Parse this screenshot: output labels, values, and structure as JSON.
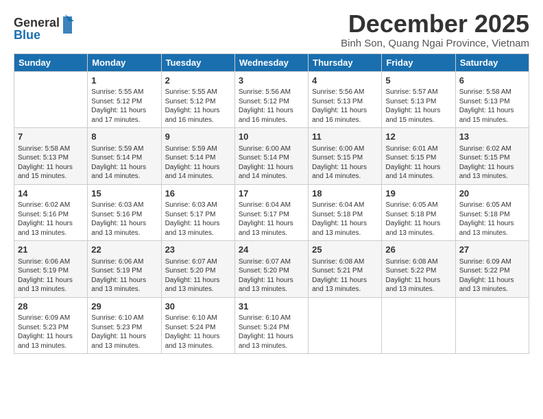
{
  "logo": {
    "line1": "General",
    "line2": "Blue"
  },
  "title": "December 2025",
  "subtitle": "Binh Son, Quang Ngai Province, Vietnam",
  "calendar": {
    "headers": [
      "Sunday",
      "Monday",
      "Tuesday",
      "Wednesday",
      "Thursday",
      "Friday",
      "Saturday"
    ],
    "weeks": [
      [
        {
          "day": "",
          "info": ""
        },
        {
          "day": "1",
          "info": "Sunrise: 5:55 AM\nSunset: 5:12 PM\nDaylight: 11 hours\nand 17 minutes."
        },
        {
          "day": "2",
          "info": "Sunrise: 5:55 AM\nSunset: 5:12 PM\nDaylight: 11 hours\nand 16 minutes."
        },
        {
          "day": "3",
          "info": "Sunrise: 5:56 AM\nSunset: 5:12 PM\nDaylight: 11 hours\nand 16 minutes."
        },
        {
          "day": "4",
          "info": "Sunrise: 5:56 AM\nSunset: 5:13 PM\nDaylight: 11 hours\nand 16 minutes."
        },
        {
          "day": "5",
          "info": "Sunrise: 5:57 AM\nSunset: 5:13 PM\nDaylight: 11 hours\nand 15 minutes."
        },
        {
          "day": "6",
          "info": "Sunrise: 5:58 AM\nSunset: 5:13 PM\nDaylight: 11 hours\nand 15 minutes."
        }
      ],
      [
        {
          "day": "7",
          "info": "Sunrise: 5:58 AM\nSunset: 5:13 PM\nDaylight: 11 hours\nand 15 minutes."
        },
        {
          "day": "8",
          "info": "Sunrise: 5:59 AM\nSunset: 5:14 PM\nDaylight: 11 hours\nand 14 minutes."
        },
        {
          "day": "9",
          "info": "Sunrise: 5:59 AM\nSunset: 5:14 PM\nDaylight: 11 hours\nand 14 minutes."
        },
        {
          "day": "10",
          "info": "Sunrise: 6:00 AM\nSunset: 5:14 PM\nDaylight: 11 hours\nand 14 minutes."
        },
        {
          "day": "11",
          "info": "Sunrise: 6:00 AM\nSunset: 5:15 PM\nDaylight: 11 hours\nand 14 minutes."
        },
        {
          "day": "12",
          "info": "Sunrise: 6:01 AM\nSunset: 5:15 PM\nDaylight: 11 hours\nand 14 minutes."
        },
        {
          "day": "13",
          "info": "Sunrise: 6:02 AM\nSunset: 5:15 PM\nDaylight: 11 hours\nand 13 minutes."
        }
      ],
      [
        {
          "day": "14",
          "info": "Sunrise: 6:02 AM\nSunset: 5:16 PM\nDaylight: 11 hours\nand 13 minutes."
        },
        {
          "day": "15",
          "info": "Sunrise: 6:03 AM\nSunset: 5:16 PM\nDaylight: 11 hours\nand 13 minutes."
        },
        {
          "day": "16",
          "info": "Sunrise: 6:03 AM\nSunset: 5:17 PM\nDaylight: 11 hours\nand 13 minutes."
        },
        {
          "day": "17",
          "info": "Sunrise: 6:04 AM\nSunset: 5:17 PM\nDaylight: 11 hours\nand 13 minutes."
        },
        {
          "day": "18",
          "info": "Sunrise: 6:04 AM\nSunset: 5:18 PM\nDaylight: 11 hours\nand 13 minutes."
        },
        {
          "day": "19",
          "info": "Sunrise: 6:05 AM\nSunset: 5:18 PM\nDaylight: 11 hours\nand 13 minutes."
        },
        {
          "day": "20",
          "info": "Sunrise: 6:05 AM\nSunset: 5:18 PM\nDaylight: 11 hours\nand 13 minutes."
        }
      ],
      [
        {
          "day": "21",
          "info": "Sunrise: 6:06 AM\nSunset: 5:19 PM\nDaylight: 11 hours\nand 13 minutes."
        },
        {
          "day": "22",
          "info": "Sunrise: 6:06 AM\nSunset: 5:19 PM\nDaylight: 11 hours\nand 13 minutes."
        },
        {
          "day": "23",
          "info": "Sunrise: 6:07 AM\nSunset: 5:20 PM\nDaylight: 11 hours\nand 13 minutes."
        },
        {
          "day": "24",
          "info": "Sunrise: 6:07 AM\nSunset: 5:20 PM\nDaylight: 11 hours\nand 13 minutes."
        },
        {
          "day": "25",
          "info": "Sunrise: 6:08 AM\nSunset: 5:21 PM\nDaylight: 11 hours\nand 13 minutes."
        },
        {
          "day": "26",
          "info": "Sunrise: 6:08 AM\nSunset: 5:22 PM\nDaylight: 11 hours\nand 13 minutes."
        },
        {
          "day": "27",
          "info": "Sunrise: 6:09 AM\nSunset: 5:22 PM\nDaylight: 11 hours\nand 13 minutes."
        }
      ],
      [
        {
          "day": "28",
          "info": "Sunrise: 6:09 AM\nSunset: 5:23 PM\nDaylight: 11 hours\nand 13 minutes."
        },
        {
          "day": "29",
          "info": "Sunrise: 6:10 AM\nSunset: 5:23 PM\nDaylight: 11 hours\nand 13 minutes."
        },
        {
          "day": "30",
          "info": "Sunrise: 6:10 AM\nSunset: 5:24 PM\nDaylight: 11 hours\nand 13 minutes."
        },
        {
          "day": "31",
          "info": "Sunrise: 6:10 AM\nSunset: 5:24 PM\nDaylight: 11 hours\nand 13 minutes."
        },
        {
          "day": "",
          "info": ""
        },
        {
          "day": "",
          "info": ""
        },
        {
          "day": "",
          "info": ""
        }
      ]
    ]
  }
}
